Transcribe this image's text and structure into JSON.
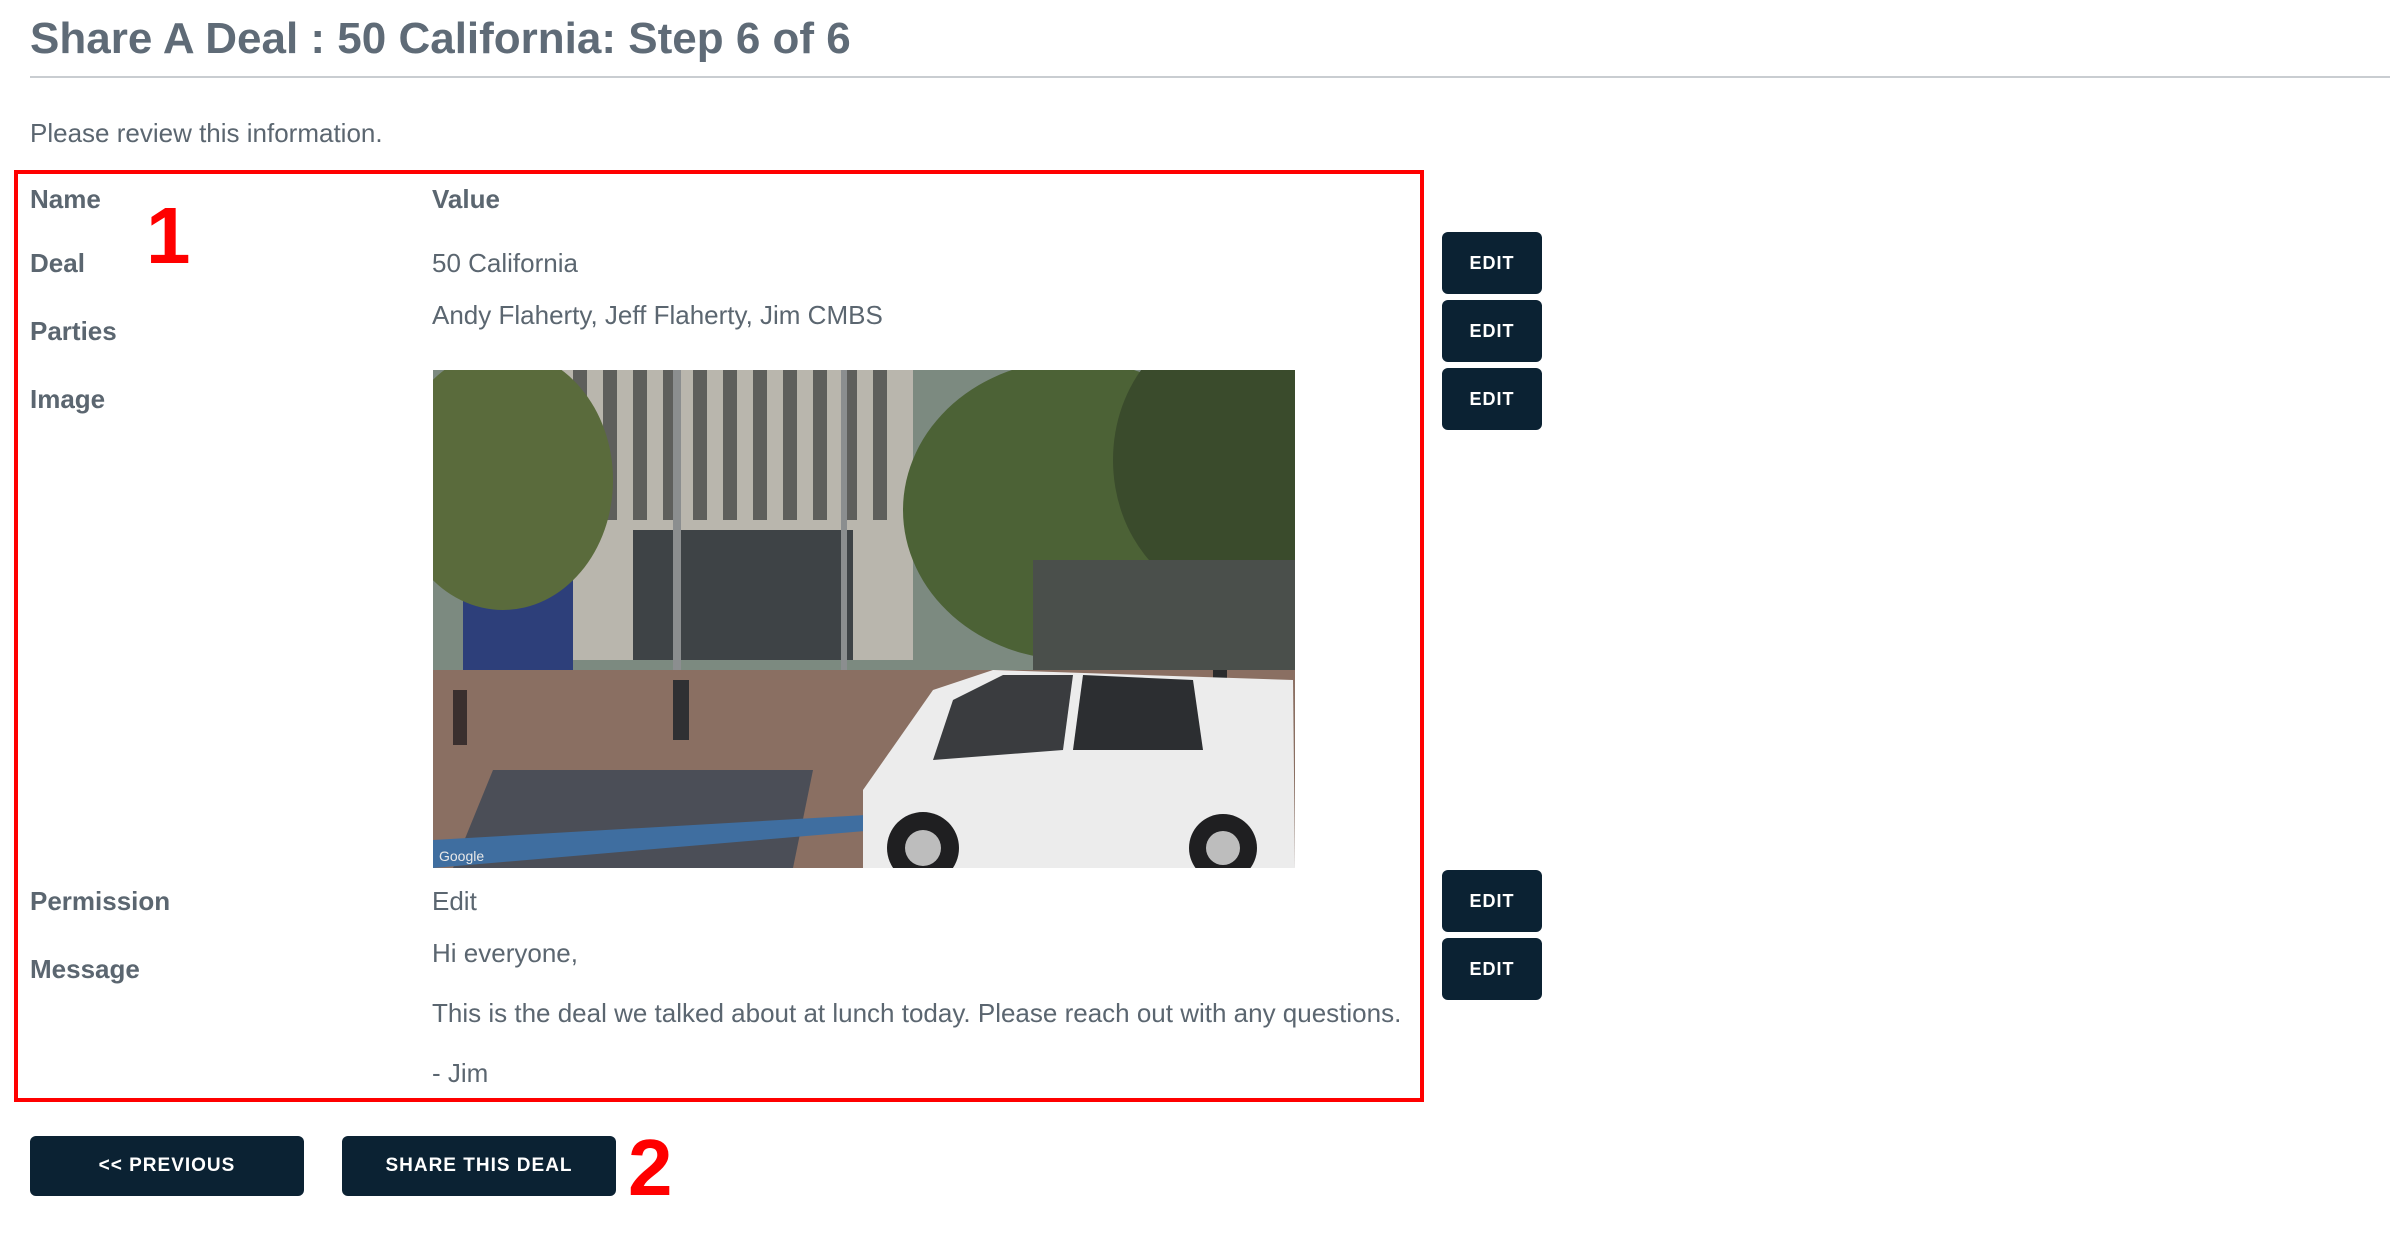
{
  "page": {
    "title": "Share A Deal : 50 California: Step 6 of 6",
    "intro": "Please review this information."
  },
  "table": {
    "header_name": "Name",
    "header_value": "Value",
    "rows": [
      {
        "label": "Deal",
        "value": "50 California",
        "edit": "EDIT"
      },
      {
        "label": "Parties",
        "value": "Andy Flaherty, Jeff Flaherty, Jim CMBS",
        "edit": "EDIT"
      },
      {
        "label": "Image",
        "edit": "EDIT",
        "image_watermark": "Google"
      },
      {
        "label": "Permission",
        "value": "Edit",
        "edit": "EDIT"
      },
      {
        "label": "Message",
        "edit": "EDIT",
        "lines": [
          "Hi everyone,",
          "This is the deal we talked about at lunch today. Please reach out with any questions.",
          "- Jim"
        ]
      }
    ]
  },
  "buttons": {
    "previous": "<< PREVIOUS",
    "share": "SHARE THIS DEAL"
  },
  "annotations": [
    "1",
    "2"
  ],
  "colors": {
    "button_bg": "#0b2233",
    "annotation_red": "#ff0000",
    "text": "#5b6670"
  }
}
